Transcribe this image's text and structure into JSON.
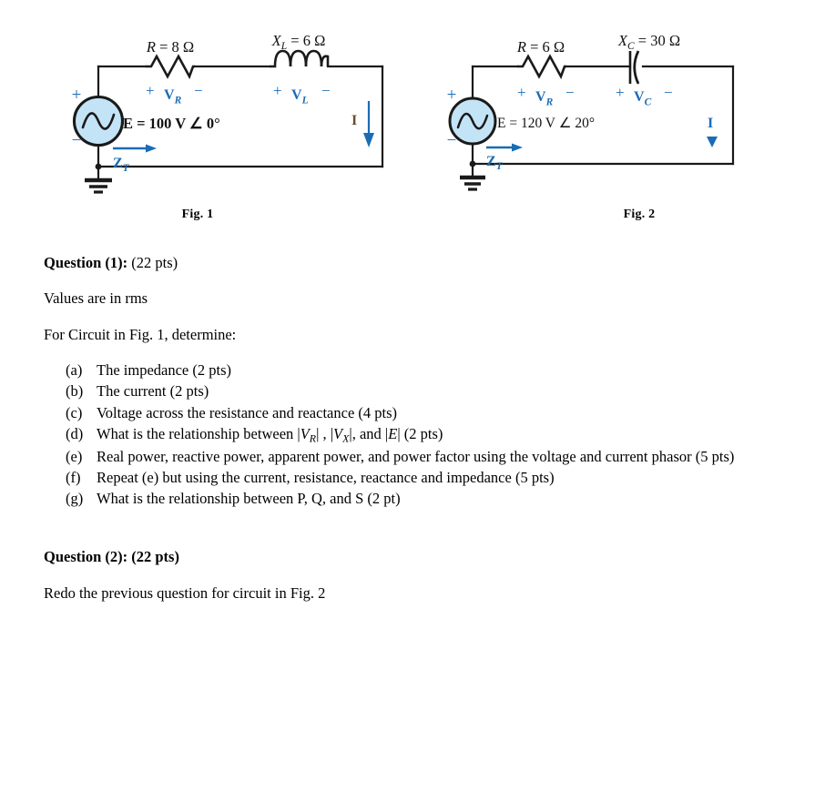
{
  "figures": [
    {
      "id": "fig-1",
      "caption": "Fig. 1",
      "source": {
        "label": "E  =  100 V ∠ 0°",
        "plus": "+",
        "minus": "−"
      },
      "impedance_label": "Z",
      "impedance_sub": "T",
      "current_label": "I",
      "components": [
        {
          "type": "resistor",
          "value_prefix": "R",
          "value_text": "  =  8 Ω",
          "drop_label": "V",
          "drop_sub": "R",
          "polarity_plus": "+",
          "polarity_minus": "−"
        },
        {
          "type": "inductor",
          "value_prefix": "X",
          "value_prefix_sub": "L",
          "value_text": "  =  6 Ω",
          "drop_label": "V",
          "drop_sub": "L",
          "polarity_plus": "+",
          "polarity_minus": "−"
        }
      ]
    },
    {
      "id": "fig-2",
      "caption": "Fig. 2",
      "source": {
        "label": "E  =  120 V ∠ 20°",
        "plus": "+",
        "minus": "−"
      },
      "impedance_label": "Z",
      "impedance_sub": "T",
      "current_label": "I",
      "components": [
        {
          "type": "resistor",
          "value_prefix": "R",
          "value_text": "  =  6 Ω",
          "drop_label": "V",
          "drop_sub": "R",
          "polarity_plus": "+",
          "polarity_minus": "−"
        },
        {
          "type": "capacitor",
          "value_prefix": "X",
          "value_prefix_sub": "C",
          "value_text": "  =  30 Ω",
          "drop_label": "V",
          "drop_sub": "C",
          "polarity_plus": "+",
          "polarity_minus": "−"
        }
      ]
    }
  ],
  "question1": {
    "heading_bold": "Question (1):",
    "heading_points": " (22 pts)",
    "note": "Values are in rms",
    "prompt": "For Circuit in Fig. 1, determine:",
    "items": [
      {
        "marker": "(a)",
        "text": "The impedance (2 pts)"
      },
      {
        "marker": "(b)",
        "text": "The current (2 pts)"
      },
      {
        "marker": "(c)",
        "text": "Voltage across the resistance and reactance (4 pts)"
      },
      {
        "marker": "(d)",
        "text": "What is the relationship between |VR| , |VX|, and |E|  (2 pts)",
        "html": true
      },
      {
        "marker": "(e)",
        "text": "Real power, reactive power, apparent power, and power factor using the voltage and current phasor (5 pts)"
      },
      {
        "marker": "(f)",
        "text": "Repeat (e) but using the current, resistance, reactance and impedance (5 pts)"
      },
      {
        "marker": "(g)",
        "text": "What is the relationship between P, Q, and S (2 pt)"
      }
    ]
  },
  "question2": {
    "heading": "Question (2): (22 pts)",
    "prompt": "Redo the previous question for circuit in Fig. 2"
  },
  "colors": {
    "accent_blue": "#1a6cb5",
    "source_fill": "#c3e4f7",
    "wire": "#1a1a1a",
    "text": "#000000"
  }
}
